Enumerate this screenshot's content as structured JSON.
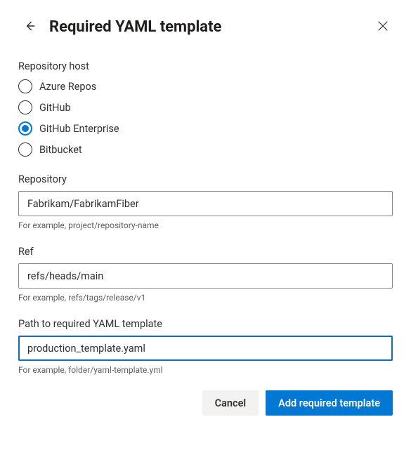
{
  "header": {
    "title": "Required YAML template"
  },
  "host": {
    "label": "Repository host",
    "options": [
      {
        "label": "Azure Repos",
        "selected": false
      },
      {
        "label": "GitHub",
        "selected": false
      },
      {
        "label": "GitHub Enterprise",
        "selected": true
      },
      {
        "label": "Bitbucket",
        "selected": false
      }
    ]
  },
  "repository": {
    "label": "Repository",
    "value": "Fabrikam/FabrikamFiber",
    "helper": "For example, project/repository-name"
  },
  "ref": {
    "label": "Ref",
    "value": "refs/heads/main",
    "helper": "For example, refs/tags/release/v1"
  },
  "path": {
    "label": "Path to required YAML template",
    "value": "production_template.yaml",
    "helper": "For example, folder/yaml-template.yml"
  },
  "footer": {
    "cancel": "Cancel",
    "submit": "Add required template"
  }
}
